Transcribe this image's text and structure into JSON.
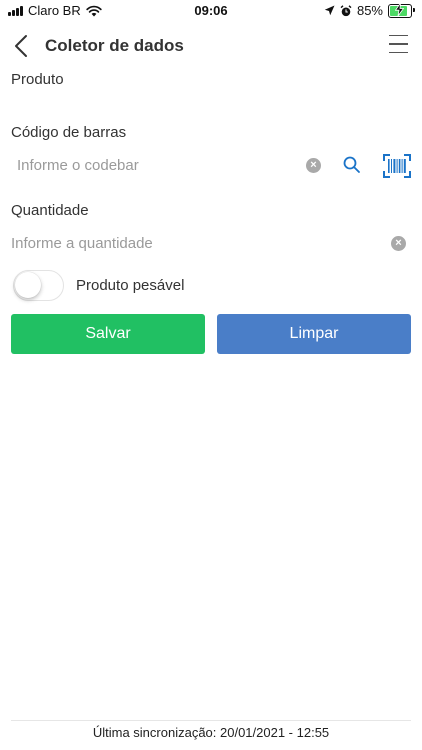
{
  "status_bar": {
    "carrier": "Claro BR",
    "time": "09:06",
    "battery_percent": "85%",
    "battery_level": 0.85,
    "battery_color": "#4cd964"
  },
  "nav": {
    "title": "Coletor de dados",
    "back_icon": "chevron-left-icon",
    "menu_icon": "hamburger-menu-icon"
  },
  "form": {
    "product_label": "Produto",
    "barcode_label": "Código de barras",
    "barcode_placeholder": "Informe o codebar",
    "barcode_value": "",
    "quantity_label": "Quantidade",
    "quantity_placeholder": "Informe a quantidade",
    "quantity_value": "",
    "weighable_label": "Produto pesável",
    "weighable_on": false
  },
  "actions": {
    "save_label": "Salvar",
    "save_color": "#21c063",
    "clear_label": "Limpar",
    "clear_color": "#4a7ec8"
  },
  "footer": {
    "last_sync": "Última sincronização: 20/01/2021 - 12:55"
  },
  "colors": {
    "icon_accent": "#1a73c8"
  }
}
